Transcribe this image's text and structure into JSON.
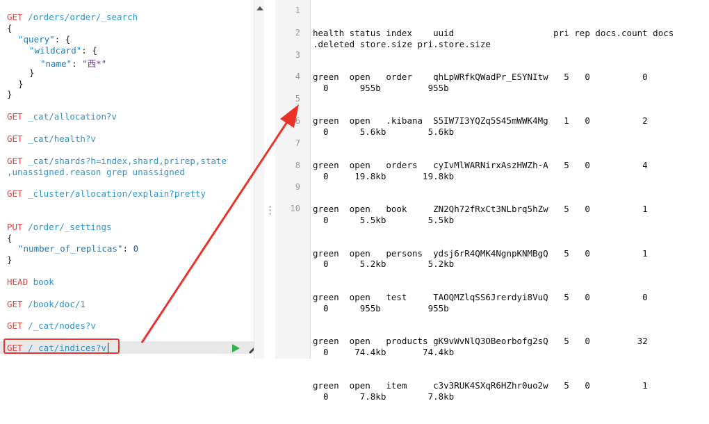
{
  "editor": {
    "lines": [
      {
        "method": "GET",
        "url": "/orders/order/_search"
      },
      {
        "text": "{"
      },
      {
        "key": "\"query\"",
        "rest": ": {"
      },
      {
        "key": "\"wildcard\"",
        "rest": ": {"
      },
      {
        "key": "\"name\"",
        "rest": ": ",
        "str": "\"西*\""
      },
      {
        "text": "}"
      },
      {
        "text": "}"
      },
      {
        "text": "}"
      },
      {
        "method": "GET",
        "url": "_cat/allocation?v"
      },
      {
        "method": "GET",
        "url": "_cat/health?v"
      },
      {
        "method": "GET",
        "url": "_cat/shards?h=index,shard,prirep,state"
      },
      {
        "url": ",unassigned.reason grep unassigned"
      },
      {
        "method": "GET",
        "url": "_cluster/allocation/explain?pretty"
      },
      {
        "method": "PUT",
        "url": "/order/_settings"
      },
      {
        "text": "{"
      },
      {
        "key": "\"number_of_replicas\"",
        "rest": ": ",
        "num": "0"
      },
      {
        "text": "}"
      },
      {
        "method": "HEAD",
        "url": "book"
      },
      {
        "method": "GET",
        "url": "/book/doc/1"
      },
      {
        "method": "GET",
        "url": "/_cat/nodes?v"
      },
      {
        "method": "GET",
        "url": "/_cat/indices?v"
      }
    ]
  },
  "response": {
    "line_numbers": [
      "1",
      "2",
      "3",
      "4",
      "5",
      "6",
      "7",
      "8",
      "9",
      "10"
    ],
    "rows": [
      "health status index    uuid                   pri rep docs.count docs\n.deleted store.size pri.store.size",
      "green  open   order    qhLpWRfkQWadPr_ESYNItw   5   0          0\n  0      955b         955b",
      "green  open   .kibana  S5IW7I3YQZq5S45mWWK4Mg   1   0          2\n  0      5.6kb        5.6kb",
      "green  open   orders   cyIvMlWARNirxAszHWZh-A   5   0          4\n  0     19.8kb       19.8kb",
      "green  open   book     ZN2Qh72fRxCt3NLbrq5hZw   5   0          1\n  0      5.5kb        5.5kb",
      "green  open   persons  ydsj6rR4QMK4NgnpKNMBgQ   5   0          1\n  0      5.2kb        5.2kb",
      "green  open   test     TAOQMZlqSS6Jrerdyi8VuQ   5   0          0\n  0      955b         955b",
      "green  open   products gK9vWvNlQ3OBeorbofg2sQ   5   0         32\n  0     74.4kb       74.4kb",
      "green  open   item     c3v3RUK4SXqR6HZhr0uo2w   5   0          1\n  0      7.8kb        7.8kb"
    ]
  },
  "colors": {
    "method": "#d9463e",
    "url": "#2f93c9",
    "highlight": "#e8322a",
    "play": "#2fb34a"
  },
  "icons": {
    "play": "play-icon",
    "wrench": "wrench-icon",
    "grip": "vertical-dots-icon"
  }
}
